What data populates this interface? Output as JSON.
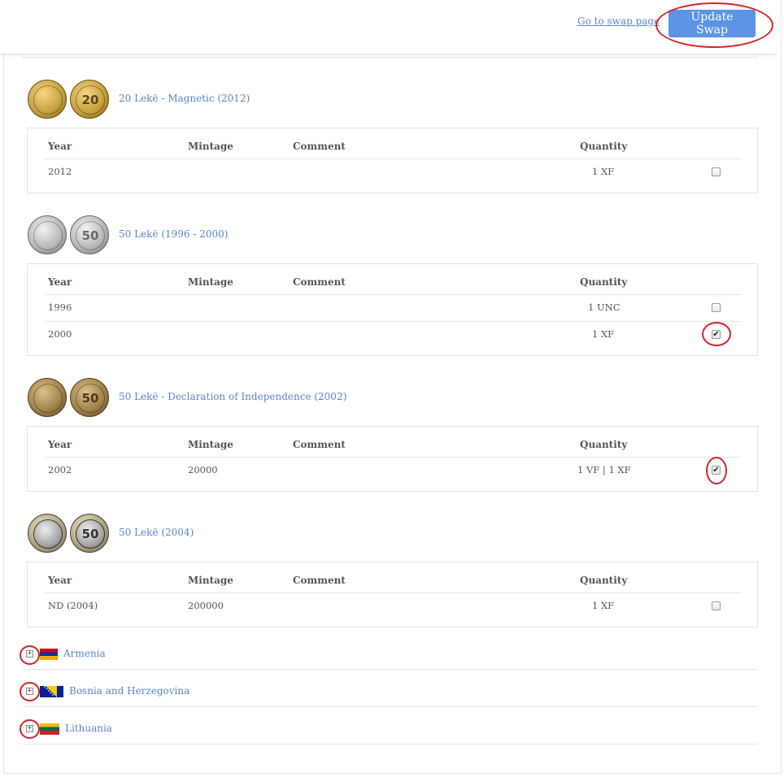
{
  "header": {
    "swap_link": "Go to swap page",
    "update_button": "Update Swap"
  },
  "columns": {
    "year": "Year",
    "mintage": "Mintage",
    "comment": "Comment",
    "quantity": "Quantity"
  },
  "coins": [
    {
      "title": "20 Lekë - Magnetic (2012)",
      "obverse_text": "",
      "reverse_text": "20",
      "rows": [
        {
          "year": "2012",
          "mintage": "",
          "comment": "",
          "quantity": "1 XF",
          "checked": false
        }
      ]
    },
    {
      "title": "50 Lekë (1996 - 2000)",
      "obverse_text": "",
      "reverse_text": "50",
      "rows": [
        {
          "year": "1996",
          "mintage": "",
          "comment": "",
          "quantity": "1 UNC",
          "checked": false
        },
        {
          "year": "2000",
          "mintage": "",
          "comment": "",
          "quantity": "1 XF",
          "checked": true
        }
      ]
    },
    {
      "title": "50 Lekë - Declaration of Independence (2002)",
      "obverse_text": "",
      "reverse_text": "50",
      "rows": [
        {
          "year": "2002",
          "mintage": "20000",
          "comment": "",
          "quantity": "1 VF | 1 XF",
          "checked": true
        }
      ]
    },
    {
      "title": "50 Lekë (2004)",
      "obverse_text": "",
      "reverse_text": "50",
      "rows": [
        {
          "year": "ND (2004)",
          "mintage": "200000",
          "comment": "",
          "quantity": "1 XF",
          "checked": false
        }
      ]
    }
  ],
  "countries": [
    {
      "name": "Armenia",
      "flag_colors": [
        "#d90012",
        "#0033a0",
        "#f2a800"
      ]
    },
    {
      "name": "Bosnia and Herzegovina",
      "flag_colors": [
        "#002395",
        "#fecb00",
        "#ffffff"
      ]
    },
    {
      "name": "Lithuania",
      "flag_colors": [
        "#fdb913",
        "#006a44",
        "#c1272d"
      ]
    }
  ],
  "colors": {
    "link": "#5a86c4",
    "button": "#5c93e5",
    "annotation_ring": "#d2232a"
  }
}
